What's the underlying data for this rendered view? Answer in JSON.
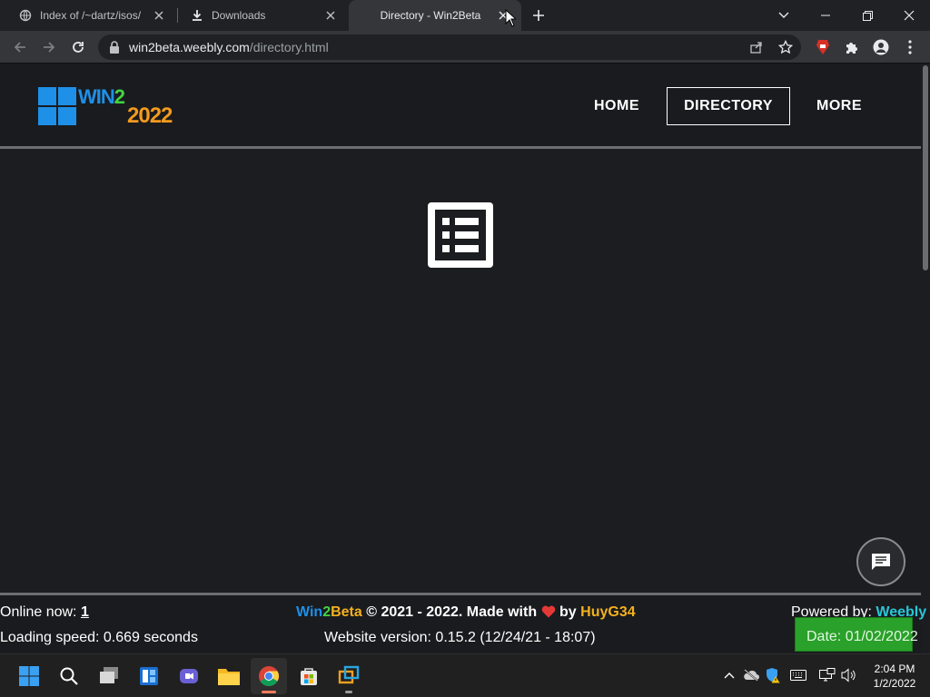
{
  "browser": {
    "tabs": [
      {
        "title": "Index of /~dartz/isos/",
        "icon": "globe-icon",
        "active": false
      },
      {
        "title": "Downloads",
        "icon": "download-icon",
        "active": false
      },
      {
        "title": "Directory - Win2Beta",
        "icon": "none",
        "active": true
      }
    ],
    "url_host": "win2beta.weebly.com",
    "url_path": "/directory.html"
  },
  "site": {
    "logo": {
      "word": "WIN",
      "num": "2",
      "year": "2022"
    },
    "nav": [
      {
        "label": "HOME",
        "active": false
      },
      {
        "label": "DIRECTORY",
        "active": true
      },
      {
        "label": "MORE",
        "active": false
      }
    ]
  },
  "footer": {
    "online_label": "Online now:",
    "online_count": "1",
    "brand_win": "Win",
    "brand_2": "2",
    "brand_beta": "Beta",
    "copyright": "© 2021 - 2022. Made with",
    "by": "by",
    "author": "HuyG34",
    "powered_label": "Powered by:",
    "powered_name": "Weebly",
    "loading": "Loading speed: 0.669 seconds",
    "version": "Website version: 0.15.2 (12/24/21 - 18:07)",
    "date": "Date: 01/02/2022"
  },
  "taskbar": {
    "time": "2:04 PM",
    "date": "1/2/2022"
  },
  "colors": {
    "accent_blue": "#1e90e8",
    "accent_green": "#42d442",
    "accent_orange": "#f39a1e",
    "heart_red": "#e53935",
    "date_green": "#2aa12a"
  }
}
